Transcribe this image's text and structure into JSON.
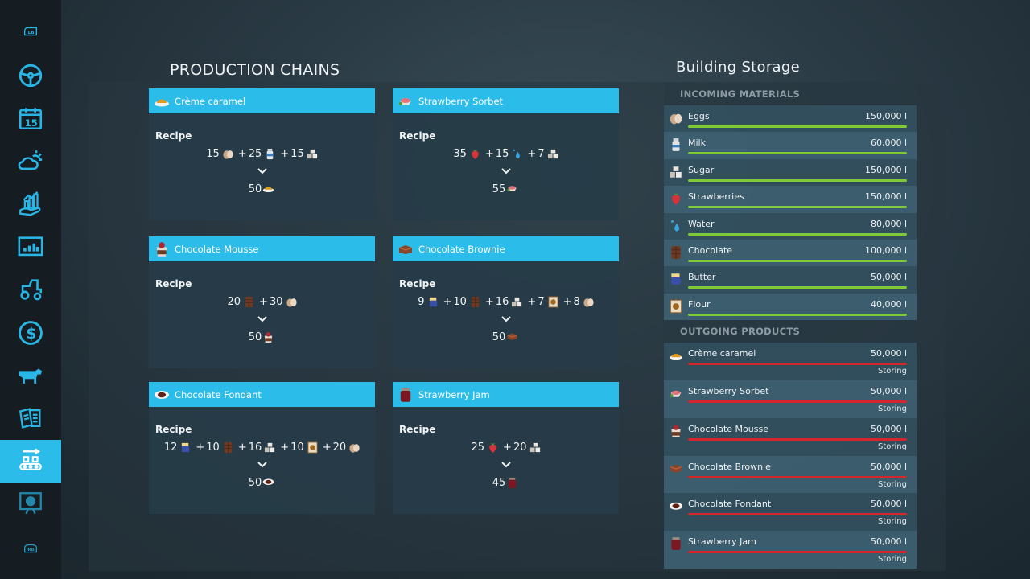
{
  "sidebar": {
    "items": [
      {
        "name": "lb-shoulder",
        "label": "LB"
      },
      {
        "name": "vehicles-steering",
        "label": ""
      },
      {
        "name": "calendar",
        "label": "15"
      },
      {
        "name": "weather",
        "label": ""
      },
      {
        "name": "prices",
        "label": ""
      },
      {
        "name": "statistics",
        "label": ""
      },
      {
        "name": "vehicles",
        "label": ""
      },
      {
        "name": "finances",
        "label": ""
      },
      {
        "name": "animals",
        "label": ""
      },
      {
        "name": "contracts",
        "label": ""
      },
      {
        "name": "production",
        "label": "",
        "active": true
      },
      {
        "name": "tour",
        "label": ""
      },
      {
        "name": "rb-shoulder",
        "label": "RB"
      }
    ]
  },
  "production_chains": {
    "title": "PRODUCTION CHAINS",
    "recipe_label": "Recipe",
    "arrow": "⌄",
    "chains": [
      {
        "name": "Crème caramel",
        "icon": "creme-caramel",
        "inputs": [
          {
            "amount": "15",
            "icon": "eggs"
          },
          {
            "amount": "25",
            "icon": "milk"
          },
          {
            "amount": "15",
            "icon": "sugar"
          }
        ],
        "output": {
          "amount": "50",
          "icon": "creme-caramel"
        }
      },
      {
        "name": "Strawberry Sorbet",
        "icon": "strawberry-sorbet",
        "inputs": [
          {
            "amount": "35",
            "icon": "strawberries"
          },
          {
            "amount": "15",
            "icon": "water"
          },
          {
            "amount": "7",
            "icon": "sugar"
          }
        ],
        "output": {
          "amount": "55",
          "icon": "strawberry-sorbet"
        }
      },
      {
        "name": "Chocolate Mousse",
        "icon": "chocolate-mousse",
        "inputs": [
          {
            "amount": "20",
            "icon": "chocolate"
          },
          {
            "amount": "30",
            "icon": "eggs"
          }
        ],
        "output": {
          "amount": "50",
          "icon": "chocolate-mousse"
        }
      },
      {
        "name": "Chocolate Brownie",
        "icon": "chocolate-brownie",
        "inputs": [
          {
            "amount": "9",
            "icon": "butter"
          },
          {
            "amount": "10",
            "icon": "chocolate"
          },
          {
            "amount": "16",
            "icon": "sugar"
          },
          {
            "amount": "7",
            "icon": "flour"
          },
          {
            "amount": "8",
            "icon": "eggs"
          }
        ],
        "output": {
          "amount": "50",
          "icon": "chocolate-brownie"
        }
      },
      {
        "name": "Chocolate Fondant",
        "icon": "chocolate-fondant",
        "inputs": [
          {
            "amount": "12",
            "icon": "butter"
          },
          {
            "amount": "10",
            "icon": "chocolate"
          },
          {
            "amount": "16",
            "icon": "sugar"
          },
          {
            "amount": "10",
            "icon": "flour"
          },
          {
            "amount": "20",
            "icon": "eggs"
          }
        ],
        "output": {
          "amount": "50",
          "icon": "chocolate-fondant"
        }
      },
      {
        "name": "Strawberry Jam",
        "icon": "strawberry-jam",
        "inputs": [
          {
            "amount": "25",
            "icon": "strawberries"
          },
          {
            "amount": "20",
            "icon": "sugar"
          }
        ],
        "output": {
          "amount": "45",
          "icon": "strawberry-jam"
        }
      }
    ]
  },
  "storage": {
    "title": "Building Storage",
    "incoming_header": "INCOMING MATERIALS",
    "outgoing_header": "OUTGOING PRODUCTS",
    "incoming": [
      {
        "name": "Eggs",
        "icon": "eggs",
        "value": "150,000 l",
        "fill": 1.0
      },
      {
        "name": "Milk",
        "icon": "milk",
        "value": "60,000 l",
        "fill": 1.0
      },
      {
        "name": "Sugar",
        "icon": "sugar",
        "value": "150,000 l",
        "fill": 1.0
      },
      {
        "name": "Strawberries",
        "icon": "strawberries",
        "value": "150,000 l",
        "fill": 1.0
      },
      {
        "name": "Water",
        "icon": "water",
        "value": "80,000 l",
        "fill": 1.0
      },
      {
        "name": "Chocolate",
        "icon": "chocolate",
        "value": "100,000 l",
        "fill": 1.0
      },
      {
        "name": "Butter",
        "icon": "butter",
        "value": "50,000 l",
        "fill": 1.0
      },
      {
        "name": "Flour",
        "icon": "flour",
        "value": "40,000 l",
        "fill": 1.0
      }
    ],
    "outgoing": [
      {
        "name": "Crème caramel",
        "icon": "creme-caramel",
        "value": "50,000 l",
        "status": "Storing",
        "fill": 1.0
      },
      {
        "name": "Strawberry Sorbet",
        "icon": "strawberry-sorbet",
        "value": "50,000 l",
        "status": "Storing",
        "fill": 1.0
      },
      {
        "name": "Chocolate Mousse",
        "icon": "chocolate-mousse",
        "value": "50,000 l",
        "status": "Storing",
        "fill": 1.0
      },
      {
        "name": "Chocolate Brownie",
        "icon": "chocolate-brownie",
        "value": "50,000 l",
        "status": "Storing",
        "fill": 1.0
      },
      {
        "name": "Chocolate Fondant",
        "icon": "chocolate-fondant",
        "value": "50,000 l",
        "status": "Storing",
        "fill": 1.0
      },
      {
        "name": "Strawberry Jam",
        "icon": "strawberry-jam",
        "value": "50,000 l",
        "status": "Storing",
        "fill": 1.0
      }
    ]
  },
  "colors": {
    "accent": "#2bbcea",
    "incoming_bar": "#7ec93a",
    "outgoing_bar": "#d4262c"
  }
}
